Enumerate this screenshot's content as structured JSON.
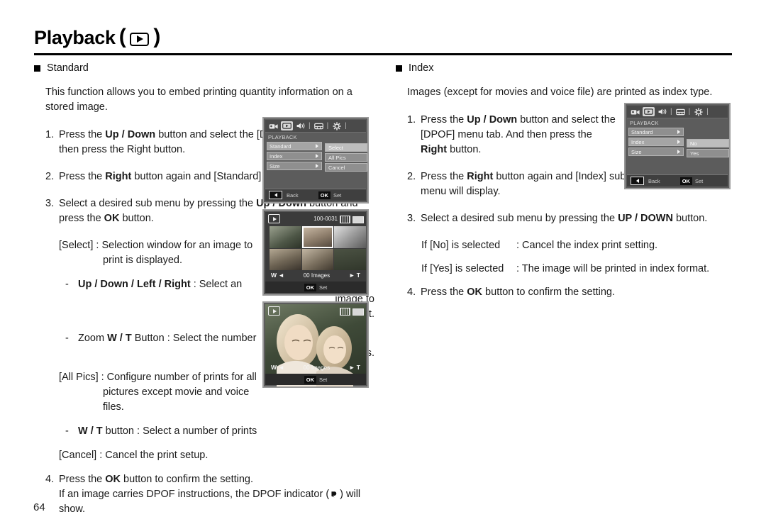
{
  "page": {
    "title": "Playback",
    "title_icon": "playback-play-icon",
    "number": "64"
  },
  "left_column": {
    "section_title": "Standard",
    "intro": "This function allows you to embed printing quantity information on a stored image.",
    "steps": [
      {
        "num": "1.",
        "parts": [
          {
            "t": "Press the ",
            "b": false
          },
          {
            "t": "Up / Down",
            "b": true
          },
          {
            "t": " button and select the [DPOF] menu tab. And then press the Right button.",
            "b": false
          }
        ]
      },
      {
        "num": "2.",
        "parts": [
          {
            "t": "Press the ",
            "b": false
          },
          {
            "t": "Right",
            "b": true
          },
          {
            "t": " button again and [Standard] sub menu will display.",
            "b": false
          }
        ]
      },
      {
        "num": "3.",
        "parts": [
          {
            "t": "Select a desired sub menu by pressing the ",
            "b": false
          },
          {
            "t": "Up / Down",
            "b": true
          },
          {
            "t": " button and press the ",
            "b": false
          },
          {
            "t": "OK",
            "b": true
          },
          {
            "t": " button.",
            "b": false
          }
        ]
      }
    ],
    "select_def_main": "[Select] : Selection window for an image to",
    "select_def_cont": "print is displayed.",
    "dash_updown_label": "Up / Down / Left / Right",
    "dash_updown_rest": " : Select an",
    "dash_updown_l2": "image to",
    "dash_updown_l3": "print.",
    "dash_zoom_pre": "Zoom ",
    "dash_zoom_label": "W / T",
    "dash_zoom_rest": " Button : Select the number",
    "dash_zoom_l2": "of prints.",
    "allpics_def_main": "[All Pics] : Configure number of prints for all",
    "allpics_def_l2": "pictures except movie and voice",
    "allpics_def_l3": "files.",
    "dash_wt_label": "W / T",
    "dash_wt_rest": " button : Select a number of prints",
    "cancel_def": "[Cancel] : Cancel the print setup.",
    "step4_num": "4.",
    "step4_pre": "Press the ",
    "step4_ok": "OK",
    "step4_post": " button to confirm the setting.",
    "step4_l2a": "If an image carries DPOF instructions, the DPOF indicator (",
    "step4_icon": "dpof-print-icon",
    "step4_l2b": ") will",
    "step4_l3": "show."
  },
  "right_column": {
    "section_title": "Index",
    "intro": "Images (except for movies and voice file) are printed as index type.",
    "steps": [
      {
        "num": "1.",
        "parts": [
          {
            "t": "Press the ",
            "b": false
          },
          {
            "t": "Up / Down",
            "b": true
          },
          {
            "t": " button and select the [DPOF] menu tab. And then press the ",
            "b": false
          },
          {
            "t": "Right",
            "b": true
          },
          {
            "t": " button.",
            "b": false
          }
        ]
      },
      {
        "num": "2.",
        "parts": [
          {
            "t": "Press the ",
            "b": false
          },
          {
            "t": "Right",
            "b": true
          },
          {
            "t": " button again and [Index] sub menu will display.",
            "b": false
          }
        ]
      },
      {
        "num": "3.",
        "parts": [
          {
            "t": "Select a desired sub menu by pressing the ",
            "b": false
          },
          {
            "t": "UP / DOWN",
            "b": true
          },
          {
            "t": " button.",
            "b": false
          }
        ]
      }
    ],
    "if_no_label": "If [No] is selected",
    "if_no_text": ": Cancel the index print setting.",
    "if_yes_label": "If [Yes] is selected",
    "if_yes_text": ": The image will be printed in index format.",
    "step4_num": "4.",
    "step4_pre": "Press the ",
    "step4_ok": "OK",
    "step4_post": " button to confirm the setting."
  },
  "lcd_menu_standard": {
    "tabs": [
      "movie-icon",
      "playback-icon",
      "sound-icon",
      "display-icon",
      "setup-icon"
    ],
    "selected_tab_index": 1,
    "menu_title": "PLAYBACK",
    "rows": [
      {
        "label": "Standard",
        "highlighted": true
      },
      {
        "label": "Index",
        "highlighted": false
      },
      {
        "label": "Size",
        "highlighted": false
      }
    ],
    "submenu": [
      {
        "label": "Select",
        "highlighted": true
      },
      {
        "label": "All Pics",
        "highlighted": false
      },
      {
        "label": "Cancel",
        "highlighted": false
      }
    ],
    "back_label": "Back",
    "ok_label": "OK",
    "set_label": "Set"
  },
  "lcd_menu_index": {
    "tabs": [
      "movie-icon",
      "playback-icon",
      "sound-icon",
      "display-icon",
      "setup-icon"
    ],
    "selected_tab_index": 1,
    "menu_title": "PLAYBACK",
    "rows": [
      {
        "label": "Standard",
        "highlighted": false
      },
      {
        "label": "Index",
        "highlighted": true
      },
      {
        "label": "Size",
        "highlighted": false
      }
    ],
    "submenu": [
      {
        "label": "No",
        "highlighted": true
      },
      {
        "label": "Yes",
        "highlighted": false
      }
    ],
    "back_label": "Back",
    "ok_label": "OK",
    "set_label": "Set"
  },
  "lcd_thumbnails": {
    "file_number": "100-0031",
    "card_icon": "memory-card-icon",
    "battery_icon": "battery-icon",
    "playback_badge": "playback-icon",
    "zoom_wide_label": "W",
    "zoom_tele_label": "T",
    "images_count_label": "00 Images",
    "ok_label": "OK",
    "set_label": "Set",
    "selected_thumb_index": 1
  },
  "lcd_fullphoto": {
    "card_icon": "memory-card-icon",
    "battery_icon": "battery-icon",
    "playback_badge": "playback-icon",
    "zoom_wide_label": "W",
    "zoom_tele_label": "T",
    "images_count_label": "00 Images",
    "ok_label": "OK",
    "set_label": "Set"
  }
}
